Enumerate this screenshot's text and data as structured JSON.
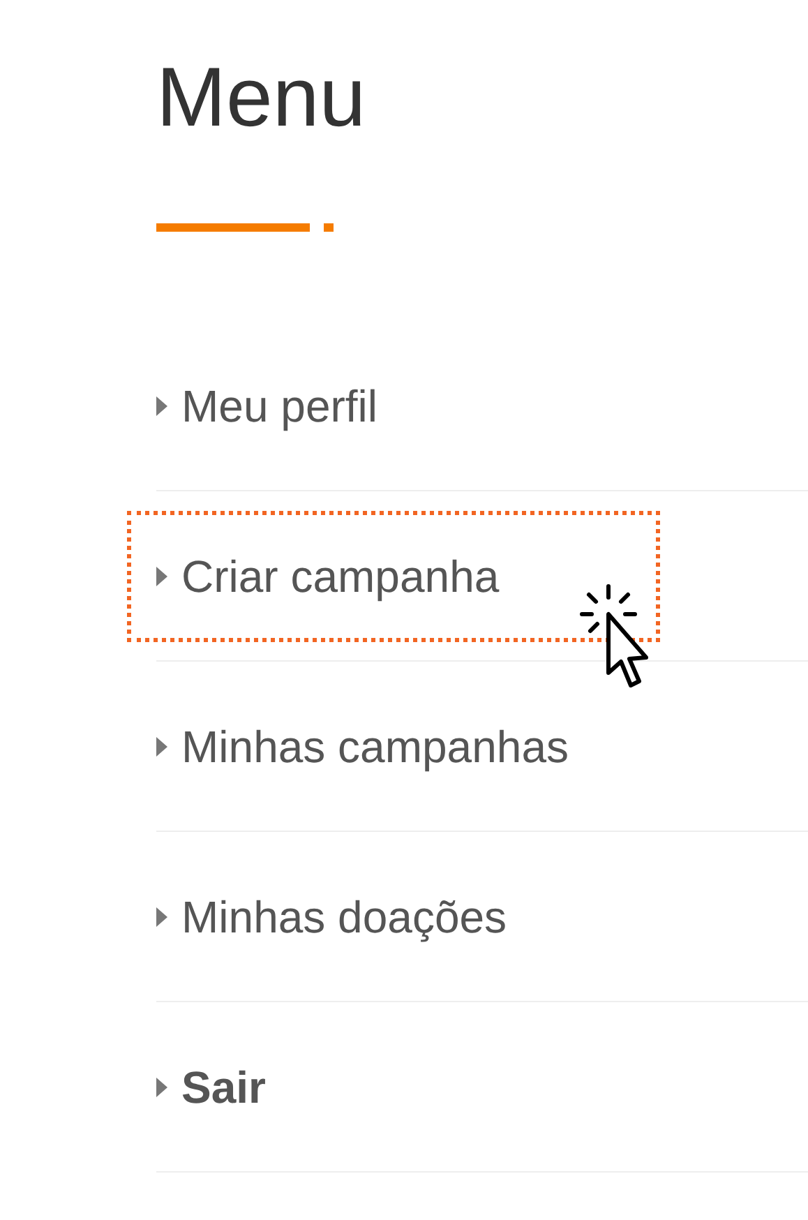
{
  "title": "Menu",
  "items": [
    {
      "label": "Meu perfil",
      "selected": false,
      "bold": false
    },
    {
      "label": "Criar campanha",
      "selected": true,
      "bold": false
    },
    {
      "label": "Minhas campanhas",
      "selected": false,
      "bold": false
    },
    {
      "label": "Minhas doações",
      "selected": false,
      "bold": false
    },
    {
      "label": "Sair",
      "selected": false,
      "bold": true
    }
  ]
}
